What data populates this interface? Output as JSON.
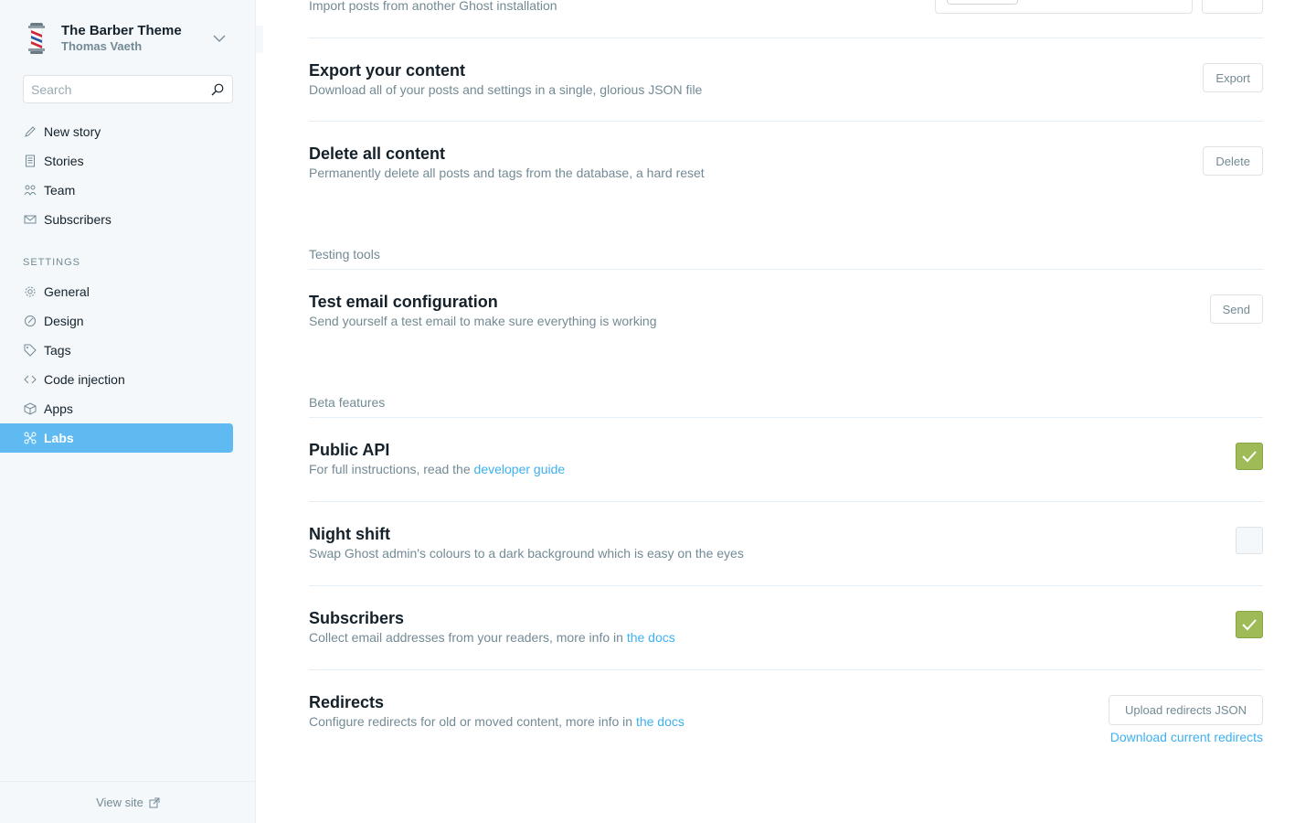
{
  "sidebar": {
    "brand_title": "The Barber Theme",
    "brand_user": "Thomas Vaeth",
    "search_placeholder": "Search",
    "nav": [
      {
        "label": "New story",
        "icon": "pencil-icon"
      },
      {
        "label": "Stories",
        "icon": "document-icon"
      },
      {
        "label": "Team",
        "icon": "team-icon"
      },
      {
        "label": "Subscribers",
        "icon": "envelope-icon"
      }
    ],
    "settings_heading": "Settings",
    "settings_nav": [
      {
        "label": "General",
        "icon": "gear-icon"
      },
      {
        "label": "Design",
        "icon": "brush-icon"
      },
      {
        "label": "Tags",
        "icon": "tag-icon"
      },
      {
        "label": "Code injection",
        "icon": "code-icon"
      },
      {
        "label": "Apps",
        "icon": "box-icon"
      },
      {
        "label": "Labs",
        "icon": "labs-icon",
        "active": true
      }
    ],
    "view_site": "View site"
  },
  "main": {
    "import_desc": "Import posts from another Ghost installation",
    "export": {
      "title": "Export your content",
      "desc": "Download all of your posts and settings in a single, glorious JSON file",
      "button": "Export"
    },
    "delete": {
      "title": "Delete all content",
      "desc": "Permanently delete all posts and tags from the database, a hard reset",
      "button": "Delete"
    },
    "testing_heading": "Testing tools",
    "test_email": {
      "title": "Test email configuration",
      "desc": "Send yourself a test email to make sure everything is working",
      "button": "Send"
    },
    "beta_heading": "Beta features",
    "public_api": {
      "title": "Public API",
      "desc_prefix": "For full instructions, read the ",
      "link": "developer guide",
      "checked": true
    },
    "night_shift": {
      "title": "Night shift",
      "desc": "Swap Ghost admin's colours to a dark background which is easy on the eyes",
      "checked": false
    },
    "subscribers": {
      "title": "Subscribers",
      "desc_prefix": "Collect email addresses from your readers, more info in ",
      "link": "the docs",
      "checked": true
    },
    "redirects": {
      "title": "Redirects",
      "desc_prefix": "Configure redirects for old or moved content, more info in ",
      "link": "the docs",
      "button": "Upload redirects JSON",
      "download_link": "Download current redirects"
    }
  },
  "colors": {
    "accent": "#5ebaf0",
    "link": "#3eb0ef",
    "checkbox_on": "#9fbb58"
  }
}
